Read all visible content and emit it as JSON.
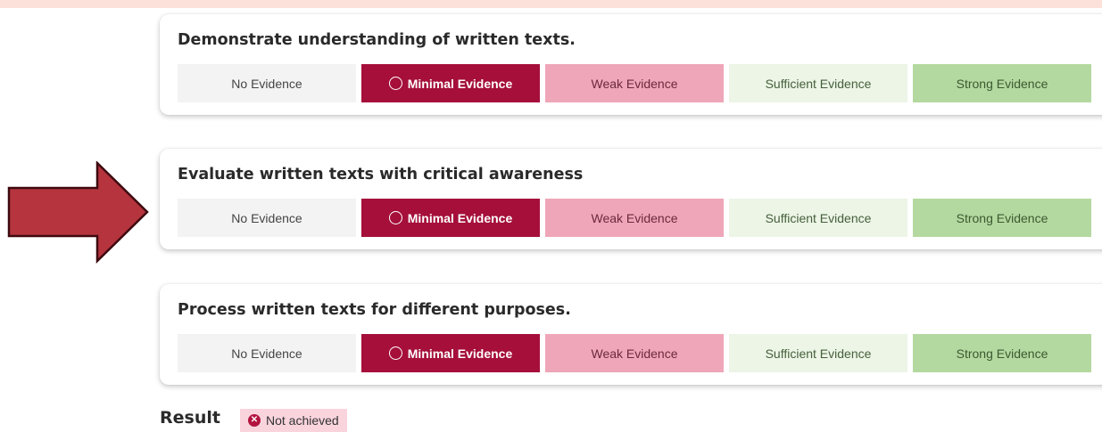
{
  "colors": {
    "top_band": "#fbe1da",
    "minimal_selected": "#a50f3a",
    "weak": "#efa6b8",
    "sufficient": "#ecf5e6",
    "strong": "#b4d9a0",
    "no_evidence": "#f3f3f3",
    "arrow_fill": "#b5343d",
    "arrow_stroke": "#3e0a10",
    "result_badge_bg": "#f9d4dd"
  },
  "options": {
    "no_evidence": "No Evidence",
    "minimal_evidence": "Minimal Evidence",
    "weak_evidence": "Weak Evidence",
    "sufficient_evidence": "Sufficient Evidence",
    "strong_evidence": "Strong Evidence"
  },
  "criteria": [
    {
      "title": "Demonstrate understanding of written texts.",
      "selected": "Minimal Evidence"
    },
    {
      "title": "Evaluate written texts with critical awareness",
      "selected": "Minimal Evidence"
    },
    {
      "title": "Process written texts for different purposes.",
      "selected": "Minimal Evidence"
    }
  ],
  "result": {
    "label": "Result",
    "status": "Not achieved",
    "status_icon": "x-circle-icon"
  },
  "annotation": {
    "icon": "right-arrow-icon"
  }
}
